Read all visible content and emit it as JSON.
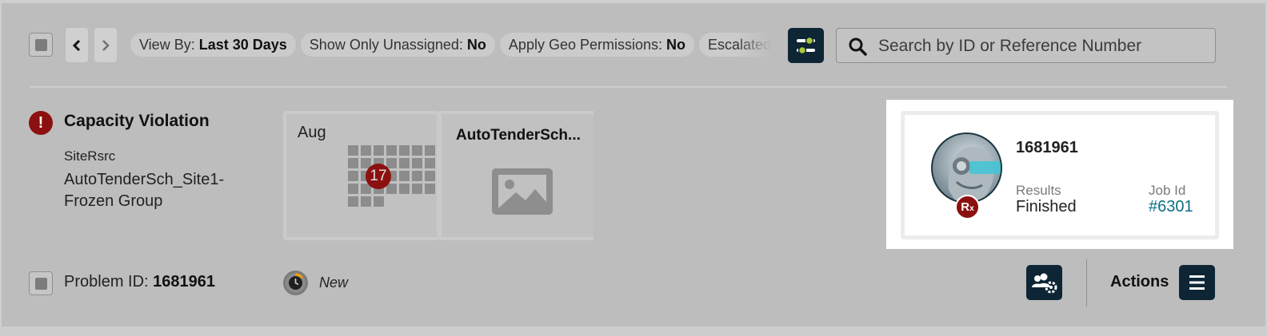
{
  "toolbar": {
    "filters": [
      {
        "key": "View By:",
        "value": "Last 30 Days"
      },
      {
        "key": "Show Only Unassigned:",
        "value": "No"
      },
      {
        "key": "Apply Geo Permissions:",
        "value": "No"
      },
      {
        "key": "Escalated",
        "value": ""
      }
    ],
    "search_placeholder": "Search by ID or Reference Number"
  },
  "problem": {
    "title": "Capacity Violation",
    "site_label": "SiteRsrc",
    "group_name": "AutoTenderSch_Site1-Frozen Group",
    "calendar": {
      "month": "Aug",
      "day": "17"
    },
    "card_title": "AutoTenderSch...",
    "problem_id_label": "Problem ID:",
    "problem_id": "1681961",
    "status": "New",
    "actions_label": "Actions"
  },
  "job_card": {
    "id": "1681961",
    "results_label": "Results",
    "results_value": "Finished",
    "job_id_label": "Job Id",
    "job_id_value": "#6301",
    "badge": "R"
  },
  "colors": {
    "dark_button": "#0d2535",
    "alert_red": "#8d1010",
    "link_teal": "#0d6f85",
    "accent_green": "#a9c93a",
    "clock_orange": "#e69a17"
  }
}
